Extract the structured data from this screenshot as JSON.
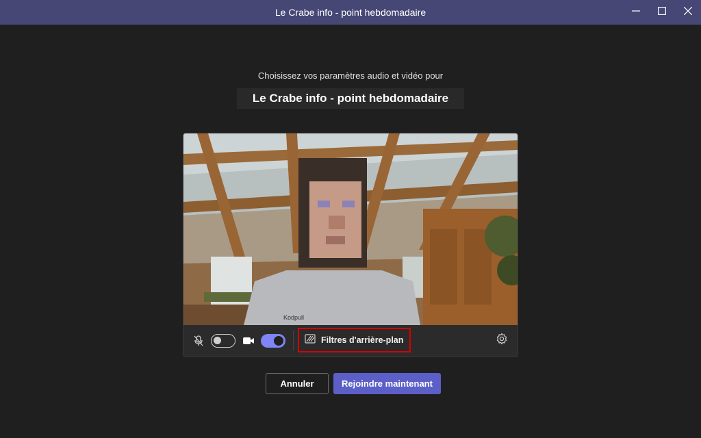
{
  "window": {
    "title": "Le Crabe info - point hebdomadaire",
    "minimize_icon": "minimize-icon",
    "maximize_icon": "maximize-icon",
    "close_icon": "close-icon"
  },
  "prejoin": {
    "subtitle": "Choisissez vos paramètres audio et vidéo pour",
    "meeting_title": "Le Crabe info - point hebdomadaire"
  },
  "controls": {
    "mic_icon": "mic-off-icon",
    "mic_enabled": false,
    "camera_icon": "video-camera-icon",
    "camera_enabled": true,
    "background_filters_icon": "background-filters-icon",
    "background_filters_label": "Filtres d'arrière-plan",
    "settings_icon": "gear-icon"
  },
  "actions": {
    "cancel_label": "Annuler",
    "join_label": "Rejoindre maintenant"
  },
  "colors": {
    "titlebar": "#464775",
    "background": "#1f1f1f",
    "accent": "#5b5fc7",
    "toggle_on": "#7f85f5",
    "highlight": "#d80000"
  }
}
